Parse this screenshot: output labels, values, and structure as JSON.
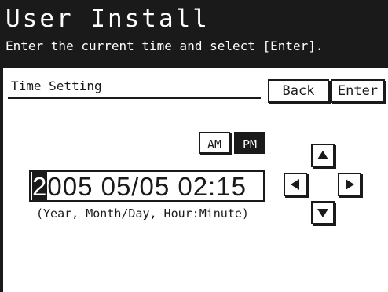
{
  "header": {
    "title": "User Install",
    "subtitle": "Enter the current time and select [Enter]."
  },
  "section": {
    "label": "Time Setting"
  },
  "buttons": {
    "back": "Back",
    "enter": "Enter"
  },
  "ampm": {
    "am": "AM",
    "pm": "PM",
    "selected": "PM"
  },
  "datetime": {
    "cursor_char": "2",
    "rest": "005 05/05 02:15"
  },
  "hint": "(Year, Month/Day,  Hour:Minute)",
  "icons": {
    "up": "arrow-up-icon",
    "down": "arrow-down-icon",
    "left": "arrow-left-icon",
    "right": "arrow-right-icon"
  },
  "colors": {
    "foreground": "#1a1a1a",
    "background": "#ffffff"
  }
}
